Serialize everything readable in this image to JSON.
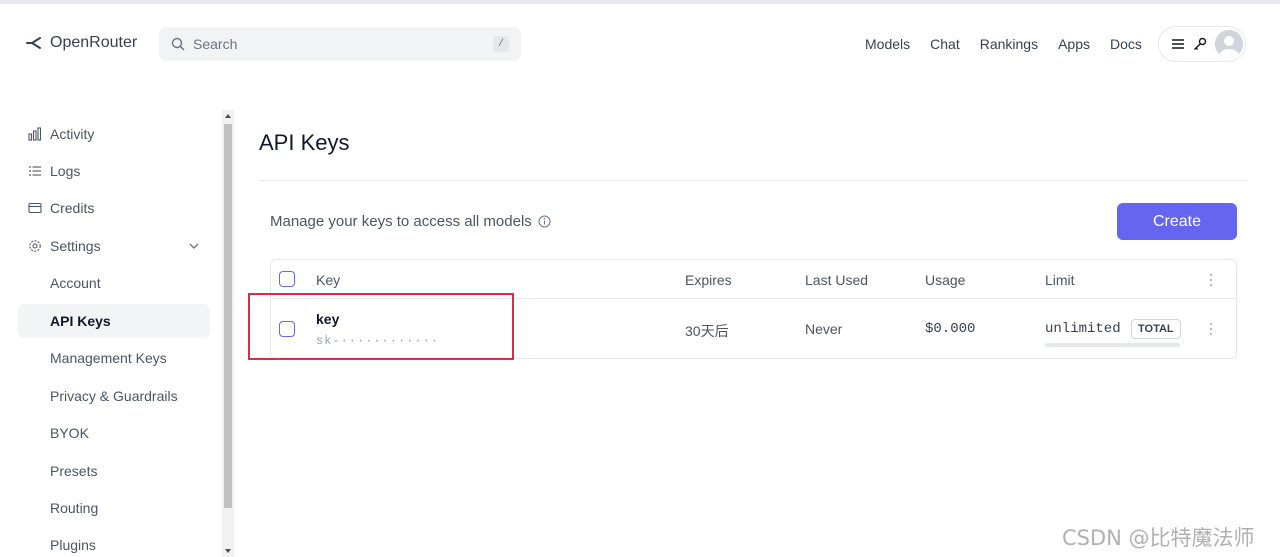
{
  "header": {
    "brand": "OpenRouter",
    "search_placeholder": "Search",
    "search_shortcut": "/",
    "nav": [
      "Models",
      "Chat",
      "Rankings",
      "Apps",
      "Docs"
    ]
  },
  "sidebar": {
    "items": [
      {
        "label": "Activity",
        "icon": "bar-chart-icon"
      },
      {
        "label": "Logs",
        "icon": "list-icon"
      },
      {
        "label": "Credits",
        "icon": "credit-card-icon"
      },
      {
        "label": "Settings",
        "icon": "gear-icon"
      },
      {
        "label": "Account"
      },
      {
        "label": "API Keys",
        "active": true
      },
      {
        "label": "Management Keys"
      },
      {
        "label": "Privacy & Guardrails"
      },
      {
        "label": "BYOK"
      },
      {
        "label": "Presets"
      },
      {
        "label": "Routing"
      },
      {
        "label": "Plugins"
      }
    ]
  },
  "main": {
    "title": "API Keys",
    "subtitle": "Manage your keys to access all models",
    "create_label": "Create",
    "table": {
      "headers": [
        "Key",
        "Expires",
        "Last Used",
        "Usage",
        "Limit"
      ],
      "rows": [
        {
          "name": "key",
          "masked": "sk-············",
          "expires": "30天后",
          "last_used": "Never",
          "usage": "$0.000",
          "limit": "unlimited",
          "limit_badge": "TOTAL"
        }
      ]
    }
  },
  "colors": {
    "accent": "#6466f1",
    "highlight": "#e0284a"
  },
  "watermark": "CSDN @比特魔法师"
}
